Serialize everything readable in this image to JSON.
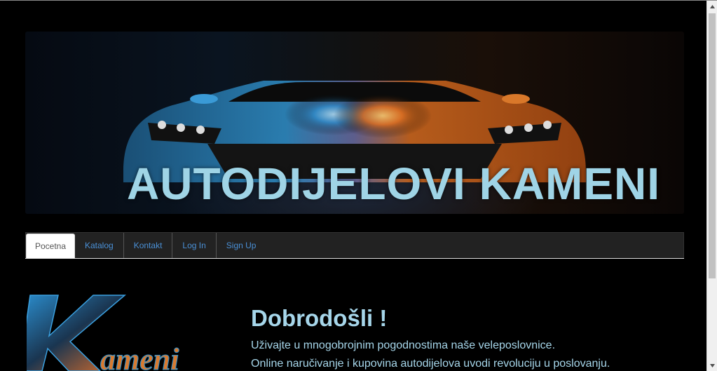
{
  "banner": {
    "title": "AUTODIJELOVI KAMENI"
  },
  "nav": {
    "tabs": [
      {
        "label": "Pocetna",
        "active": true
      },
      {
        "label": "Katalog",
        "active": false
      },
      {
        "label": "Kontakt",
        "active": false
      },
      {
        "label": "Log In",
        "active": false
      },
      {
        "label": "Sign Up",
        "active": false
      }
    ]
  },
  "welcome": {
    "title": "Dobrodošli !",
    "line1": "Uživajte u mnogobrojnim pogodnostima naše veleposlovnice.",
    "line2": "Online naručivanje i kupovina autodijelova uvodi revoluciju u poslovanju."
  },
  "logo": {
    "text": "Kameni"
  },
  "colors": {
    "accent_text": "#a6d6ea",
    "nav_link": "#4a90d6",
    "background": "#000000"
  }
}
